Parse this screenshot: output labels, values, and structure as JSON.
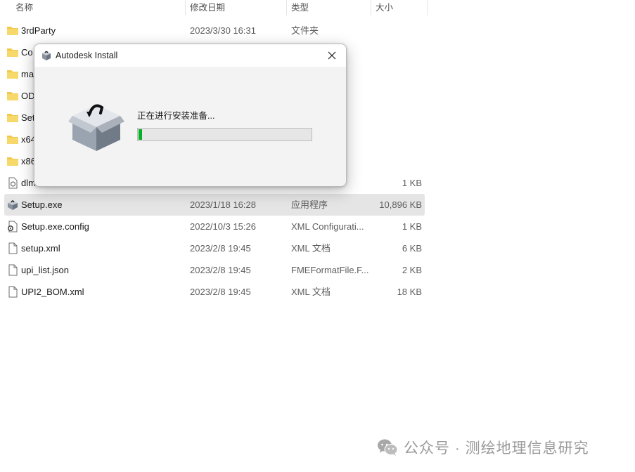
{
  "columns": {
    "name": "名称",
    "modified": "修改日期",
    "type": "类型",
    "size": "大小"
  },
  "files": [
    {
      "name": "3rdParty",
      "date": "2023/3/30 16:31",
      "type": "文件夹",
      "size": "",
      "icon": "folder-icon"
    },
    {
      "name": "Co",
      "date": "",
      "type": "",
      "size": "",
      "icon": "folder-icon"
    },
    {
      "name": "ma",
      "date": "",
      "type": "",
      "size": "",
      "icon": "folder-icon"
    },
    {
      "name": "OD",
      "date": "",
      "type": "",
      "size": "",
      "icon": "folder-icon"
    },
    {
      "name": "Set",
      "date": "",
      "type": "",
      "size": "",
      "icon": "folder-icon"
    },
    {
      "name": "x64",
      "date": "",
      "type": "",
      "size": "",
      "icon": "folder-icon"
    },
    {
      "name": "x86",
      "date": "",
      "type": "",
      "size": "",
      "icon": "folder-icon"
    },
    {
      "name": "dlm...",
      "date": "",
      "type": "",
      "size": "1 KB",
      "icon": "settings-file-icon"
    },
    {
      "name": "Setup.exe",
      "date": "2023/1/18 16:28",
      "type": "应用程序",
      "size": "10,896 KB",
      "icon": "installer-icon",
      "selected": true
    },
    {
      "name": "Setup.exe.config",
      "date": "2022/10/3 15:26",
      "type": "XML Configurati...",
      "size": "1 KB",
      "icon": "config-file-icon"
    },
    {
      "name": "setup.xml",
      "date": "2023/2/8 19:45",
      "type": "XML 文档",
      "size": "6 KB",
      "icon": "file-icon"
    },
    {
      "name": "upi_list.json",
      "date": "2023/2/8 19:45",
      "type": "FMEFormatFile.F...",
      "size": "2 KB",
      "icon": "file-icon"
    },
    {
      "name": "UPI2_BOM.xml",
      "date": "2023/2/8 19:45",
      "type": "XML 文档",
      "size": "18 KB",
      "icon": "file-icon"
    }
  ],
  "dialog": {
    "title": "Autodesk Install",
    "message": "正在进行安装准备...",
    "progress": 0.02,
    "progress_color": "#06b025",
    "icons": [
      "autodesk-install-icon",
      "box-icon",
      "close-icon"
    ]
  },
  "watermark": {
    "text": "公众号 · 测绘地理信息研究",
    "icon": "wechat-icon"
  }
}
